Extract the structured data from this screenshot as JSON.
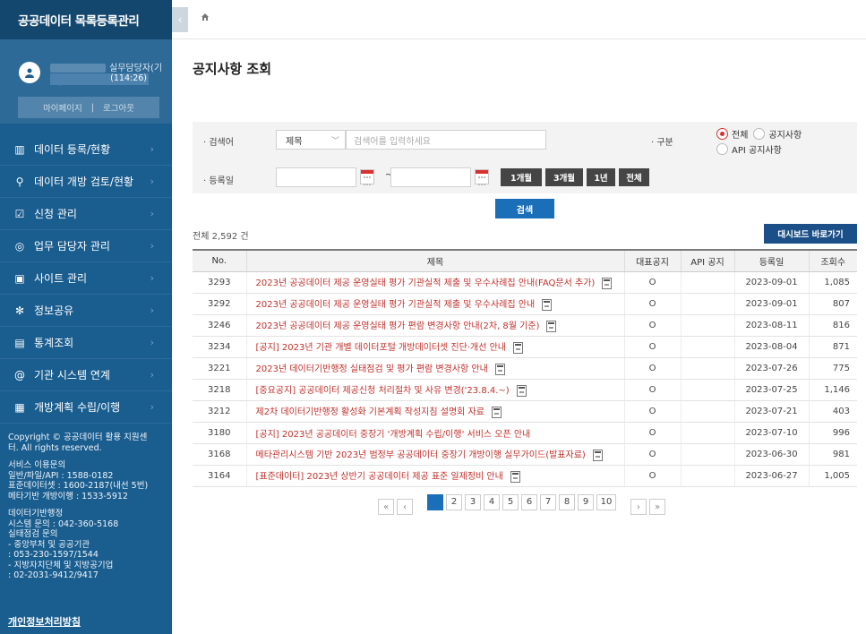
{
  "sidebar": {
    "brand": "공공데이터 목록등록관리",
    "user_role": "실무담당자(기관)",
    "session_time": "(114:26)",
    "mypage": "마이페이지",
    "divider": "|",
    "logout": "로그아웃",
    "items": [
      {
        "label": "데이터 등록/현황",
        "icon": "bar-chart-icon",
        "glyph": "▥"
      },
      {
        "label": "데이터 개방 검토/현황",
        "icon": "search-icon",
        "glyph": "⚲"
      },
      {
        "label": "신청 관리",
        "icon": "form-icon",
        "glyph": "☑"
      },
      {
        "label": "업무 담당자 관리",
        "icon": "user-manage-icon",
        "glyph": "◎"
      },
      {
        "label": "사이트 관리",
        "icon": "monitor-icon",
        "glyph": "▣"
      },
      {
        "label": "정보공유",
        "icon": "share-icon",
        "glyph": "✻"
      },
      {
        "label": "통계조회",
        "icon": "stats-icon",
        "glyph": "▤"
      },
      {
        "label": "기관 시스템 연계",
        "icon": "link-icon",
        "glyph": "@"
      },
      {
        "label": "개방계획 수립/이행",
        "icon": "plan-icon",
        "glyph": "▦"
      }
    ],
    "copyright": [
      "Copyright © 공공데이터 활용 지원센",
      "터. All rights reserved."
    ],
    "service": [
      "서비스 이용문의",
      "일반/파일/API : 1588-0182",
      "표준데이터셋 : 1600-2187(내선 5번)",
      "메타기반 개방이행 : 1533-5912"
    ],
    "contact": [
      "데이터기반행정",
      "시스템 문의 : 042-360-5168",
      "실태점검 문의",
      "- 중앙부처 및 공공기관",
      ": 053-230-1597/1544",
      "- 지방자치단체 및 지방공기업",
      ": 02-2031-9412/9417"
    ],
    "privacy": "개인정보처리방침"
  },
  "page": {
    "title": "공지사항 조회"
  },
  "search": {
    "keyword_label": "· 검색어",
    "field_select": "제목",
    "keyword_placeholder": "검색어를 입력하세요",
    "type_label": "· 구분",
    "radio_all": "전체",
    "radio_notice": "공지사항",
    "radio_api": "API 공지사항",
    "date_label": "· 등록일",
    "tilde": "~",
    "period_1m": "1개월",
    "period_3m": "3개월",
    "period_1y": "1년",
    "period_all": "전체",
    "search_button": "검색"
  },
  "list": {
    "total": "전체 2,592 건",
    "dashboard_button": "대시보드 바로가기",
    "columns": [
      "No.",
      "제목",
      "대표공지",
      "API 공지",
      "등록일",
      "조회수"
    ],
    "rows": [
      {
        "no": "3293",
        "title": "2023년 공공데이터 제공 운영실태 평가 기관실적 제출 및 우수사례집 안내(FAQ문서 추가)",
        "rep": "O",
        "api": "",
        "date": "2023-09-01",
        "views": "1,085"
      },
      {
        "no": "3292",
        "title": "2023년 공공데이터 제공 운영실태 평가 기관실적 제출 및 우수사례집 안내",
        "rep": "O",
        "api": "",
        "date": "2023-09-01",
        "views": "807"
      },
      {
        "no": "3246",
        "title": "2023년 공공데이터 제공 운영실태 평가 편람 변경사항 안내(2차, 8월 기준)",
        "rep": "O",
        "api": "",
        "date": "2023-08-11",
        "views": "816"
      },
      {
        "no": "3234",
        "title": "[공지] 2023년 기관 개별 데이터포털 개방데이터셋 진단·개선 안내",
        "rep": "O",
        "api": "",
        "date": "2023-08-04",
        "views": "871"
      },
      {
        "no": "3221",
        "title": "2023년 데이터기반행정 실태점검 및 평가 편람 변경사항 안내",
        "rep": "O",
        "api": "",
        "date": "2023-07-26",
        "views": "775"
      },
      {
        "no": "3218",
        "title": "[중요공지] 공공데이터 제공신청 처리절차 및 사유 변경('23.8.4.~)",
        "rep": "O",
        "api": "",
        "date": "2023-07-25",
        "views": "1,146"
      },
      {
        "no": "3212",
        "title": "제2차 데이터기반행정 활성화 기본계획 작성지침 설명회 자료",
        "rep": "O",
        "api": "",
        "date": "2023-07-21",
        "views": "403"
      },
      {
        "no": "3180",
        "title": "[공지] 2023년 공공데이터 중장기 '개방계획 수립/이행' 서비스 오픈 안내",
        "rep": "O",
        "api": "",
        "date": "2023-07-10",
        "views": "996"
      },
      {
        "no": "3168",
        "title": "메타관리시스템 기반 2023년 범정부 공공데이터 중장기 개방이행 실무가이드(발표자료)",
        "rep": "O",
        "api": "",
        "date": "2023-06-30",
        "views": "981"
      },
      {
        "no": "3164",
        "title": "[표준데이터] 2023년 상반기 공공데이터 제공 표준 일제정비 안내",
        "rep": "O",
        "api": "",
        "date": "2023-06-27",
        "views": "1,005"
      }
    ]
  },
  "pagination": {
    "first": "«",
    "prev": "‹",
    "pages": [
      "1",
      "2",
      "3",
      "4",
      "5",
      "6",
      "7",
      "8",
      "9",
      "10"
    ],
    "next": "›",
    "last": "»"
  }
}
